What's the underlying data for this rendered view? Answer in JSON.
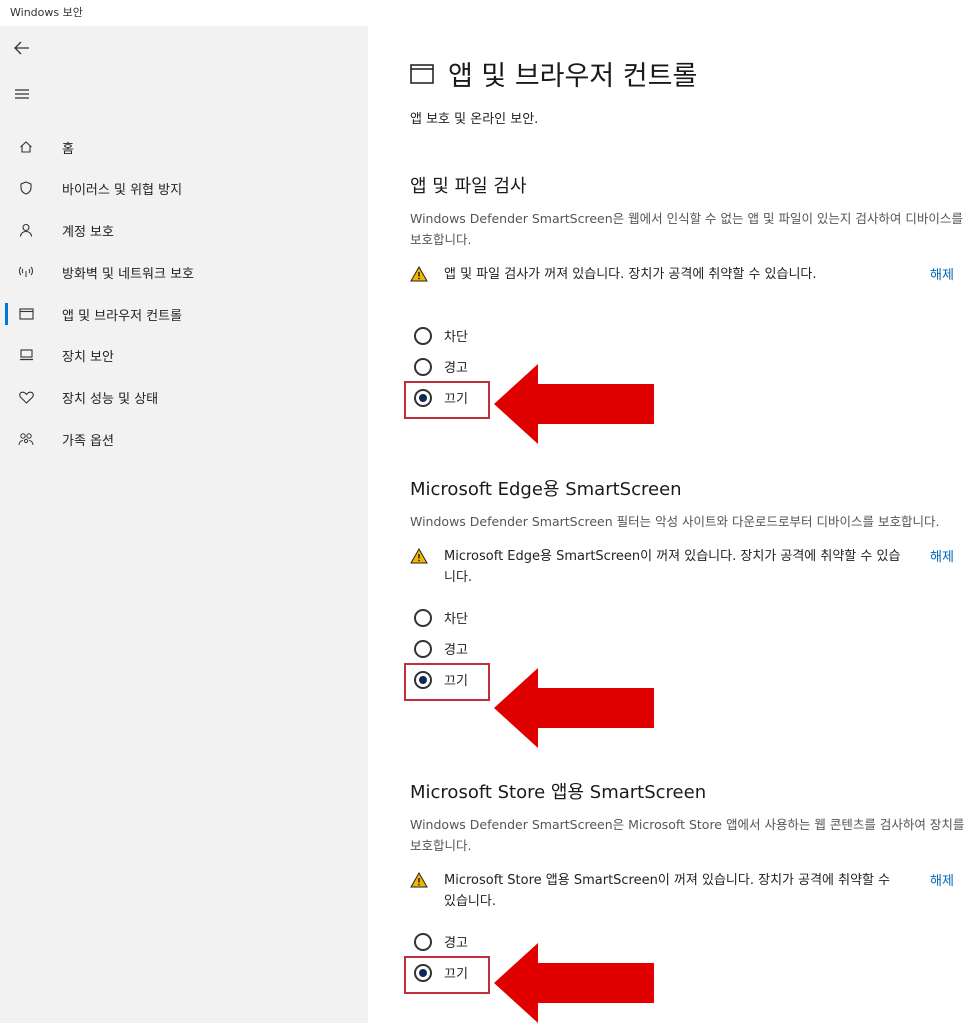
{
  "window": {
    "title": "Windows 보안"
  },
  "sidebar": {
    "back_icon": "arrow-left-icon",
    "menu_icon": "hamburger-icon",
    "items": [
      {
        "label": "홈",
        "icon": "home-icon"
      },
      {
        "label": "바이러스 및 위협 방지",
        "icon": "shield-icon"
      },
      {
        "label": "계정 보호",
        "icon": "person-icon"
      },
      {
        "label": "방화벽 및 네트워크 보호",
        "icon": "wireless-icon"
      },
      {
        "label": "앱 및 브라우저 컨트롤",
        "icon": "app-window-icon",
        "active": true
      },
      {
        "label": "장치 보안",
        "icon": "device-icon"
      },
      {
        "label": "장치 성능 및 상태",
        "icon": "heart-icon"
      },
      {
        "label": "가족 옵션",
        "icon": "family-icon"
      }
    ]
  },
  "page": {
    "title": "앱 및 브라우저 컨트롤",
    "subtitle": "앱 보호 및 온라인 보안."
  },
  "sections": [
    {
      "title": "앱 및 파일 검사",
      "description": "Windows Defender SmartScreen은 웹에서 인식할 수 없는 앱 및 파일이 있는지 검사하여 디바이스를 보호합니다.",
      "warning": "앱 및 파일 검사가 꺼져 있습니다. 장치가 공격에 취약할 수 있습니다.",
      "link": "해제",
      "options": [
        "차단",
        "경고",
        "끄기"
      ],
      "selected": "끄기"
    },
    {
      "title": "Microsoft Edge용 SmartScreen",
      "description": "Windows Defender SmartScreen 필터는 악성 사이트와 다운로드로부터 디바이스를 보호합니다.",
      "warning": "Microsoft Edge용 SmartScreen이 꺼져 있습니다. 장치가 공격에 취약할 수 있습니다.",
      "link": "해제",
      "options": [
        "차단",
        "경고",
        "끄기"
      ],
      "selected": "끄기"
    },
    {
      "title": "Microsoft Store 앱용 SmartScreen",
      "description": "Windows Defender SmartScreen은 Microsoft Store 앱에서 사용하는 웹 콘텐츠를 검사하여 장치를 보호합니다.",
      "warning": "Microsoft Store 앱용 SmartScreen이 꺼져 있습니다. 장치가 공격에 취약할 수 있습니다.",
      "link": "해제",
      "options": [
        "경고",
        "끄기"
      ],
      "selected": "끄기"
    }
  ],
  "colors": {
    "accent": "#0078d7",
    "link": "#0066b4",
    "annotation_red": "#e00000",
    "warning_yellow": "#f2b600"
  }
}
